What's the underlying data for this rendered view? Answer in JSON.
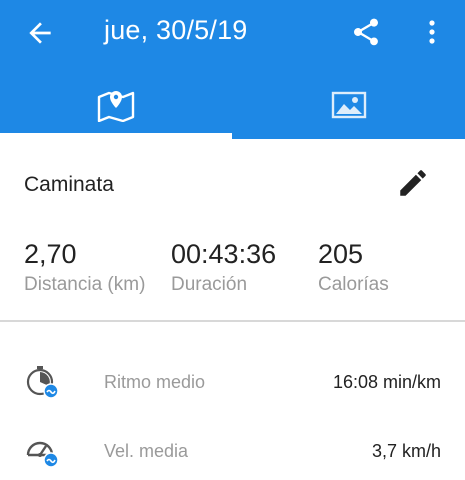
{
  "appbar": {
    "title": "jue, 30/5/19"
  },
  "icons": {
    "back": "arrow-back-icon",
    "share": "share-icon",
    "more": "more-vert-icon",
    "map": "map-icon",
    "photo": "photo-icon",
    "edit": "pencil-icon",
    "pace": "stopwatch-icon",
    "speed": "speedometer-icon"
  },
  "colors": {
    "primary": "#1e88e5",
    "label": "#9a9a9a",
    "text": "#222222"
  },
  "tabs": {
    "selected": "map"
  },
  "activity": {
    "name": "Caminata"
  },
  "stats": [
    {
      "value": "2,70",
      "label": "Distancia (km)"
    },
    {
      "value": "00:43:36",
      "label": "Duración"
    },
    {
      "value": "205",
      "label": "Calorías"
    }
  ],
  "metrics": [
    {
      "label": "Ritmo medio",
      "value": "16:08 min/km"
    },
    {
      "label": "Vel. media",
      "value": "3,7 km/h"
    }
  ]
}
